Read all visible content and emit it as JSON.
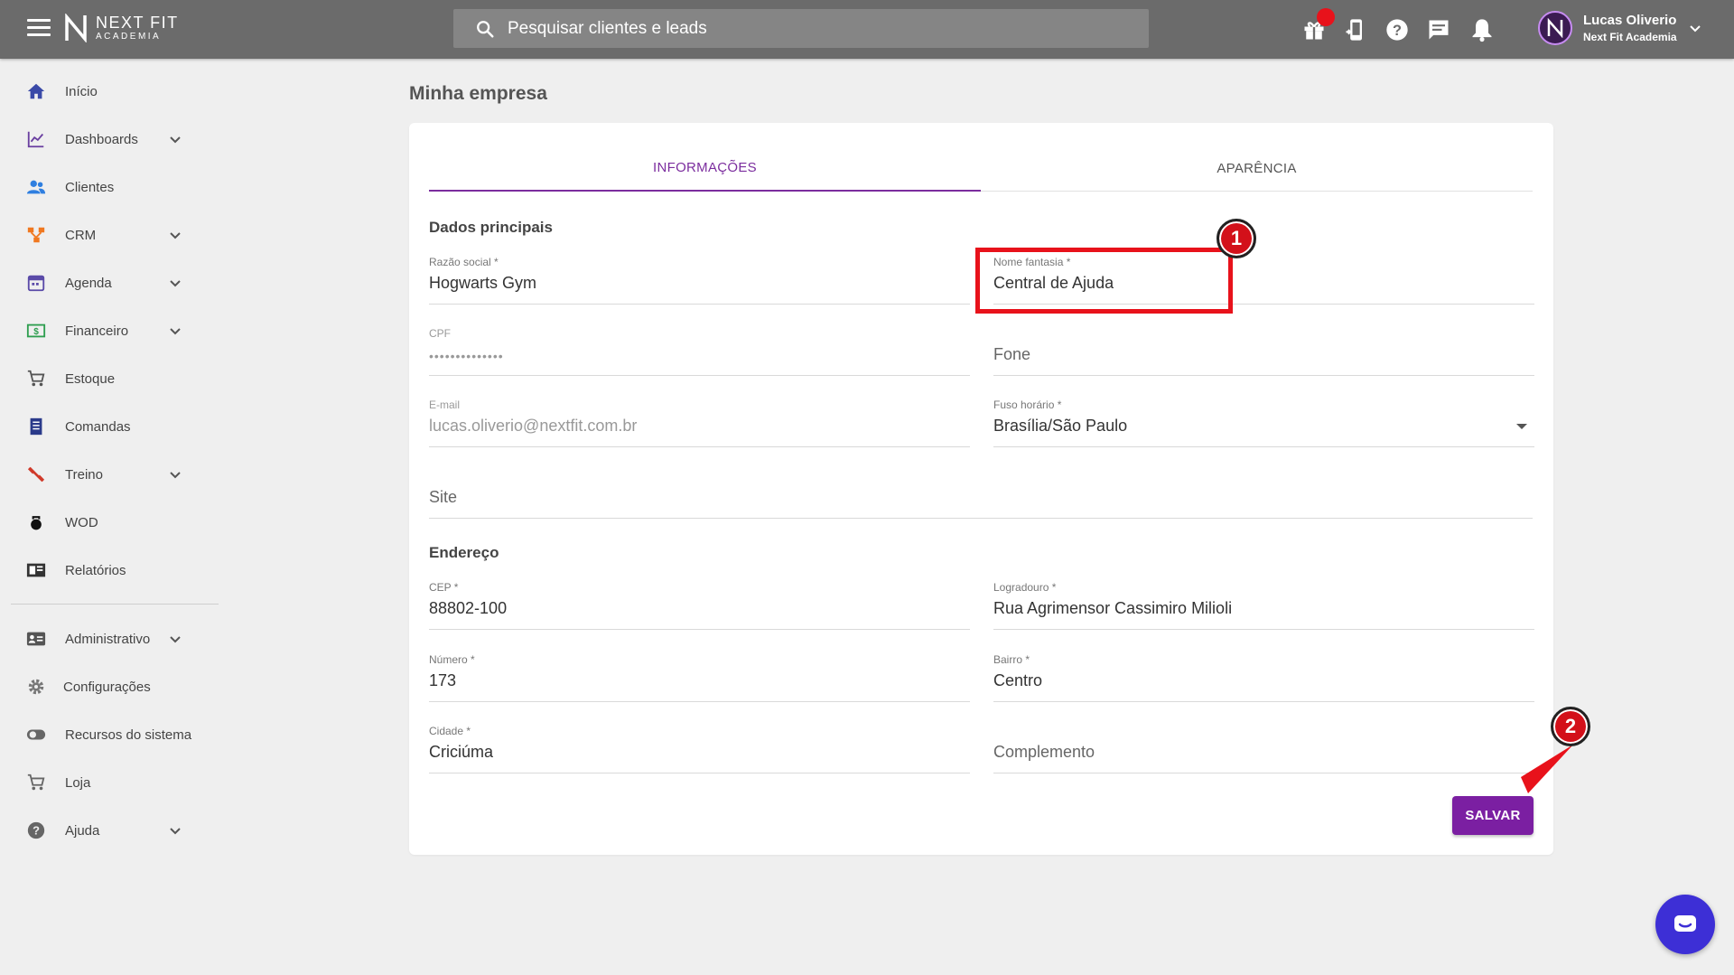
{
  "brand": {
    "name": "NEXT FIT",
    "subtitle": "ACADEMIA"
  },
  "search": {
    "placeholder": "Pesquisar clientes e leads"
  },
  "user": {
    "name": "Lucas Oliverio",
    "company": "Next Fit Academia"
  },
  "sidebar": {
    "items": [
      {
        "label": "Início",
        "icon": "home-icon",
        "color": "#3a4aa8"
      },
      {
        "label": "Dashboards",
        "icon": "chart-line-icon",
        "color": "#6a3fa0"
      },
      {
        "label": "Clientes",
        "icon": "people-icon",
        "color": "#2f7fe0"
      },
      {
        "label": "CRM",
        "icon": "crm-icon",
        "color": "#f07820"
      },
      {
        "label": "Agenda",
        "icon": "calendar-icon",
        "color": "#5a4aa8"
      },
      {
        "label": "Financeiro",
        "icon": "money-icon",
        "color": "#2e9e4f"
      },
      {
        "label": "Estoque",
        "icon": "cart-icon",
        "color": "#555555"
      },
      {
        "label": "Comandas",
        "icon": "receipt-icon",
        "color": "#2a3a8a"
      },
      {
        "label": "Treino",
        "icon": "dumbbell-icon",
        "color": "#d03a2a"
      },
      {
        "label": "WOD",
        "icon": "kettlebell-icon",
        "color": "#111111"
      },
      {
        "label": "Relatórios",
        "icon": "report-icon",
        "color": "#333333"
      },
      {
        "label": "Administrativo",
        "icon": "id-card-icon",
        "color": "#555555"
      },
      {
        "label": "Configurações",
        "icon": "gear-icon",
        "color": "#777777"
      },
      {
        "label": "Recursos do sistema",
        "icon": "toggle-icon",
        "color": "#666666"
      },
      {
        "label": "Loja",
        "icon": "cart-icon",
        "color": "#666666"
      },
      {
        "label": "Ajuda",
        "icon": "help-icon",
        "color": "#666666"
      }
    ]
  },
  "page": {
    "title": "Minha empresa"
  },
  "tabs": [
    {
      "label": "INFORMAÇÕES"
    },
    {
      "label": "APARÊNCIA"
    }
  ],
  "sections": {
    "main": "Dados principais",
    "address": "Endereço"
  },
  "fields": {
    "razao_social": {
      "label": "Razão social *",
      "value": "Hogwarts Gym"
    },
    "nome_fantasia": {
      "label": "Nome fantasia *",
      "value": "Central de Ajuda"
    },
    "cpf": {
      "label": "CPF",
      "value": "••••••••••••••"
    },
    "fone": {
      "placeholder": "Fone"
    },
    "email": {
      "label": "E-mail",
      "value": "lucas.oliverio@nextfit.com.br"
    },
    "fuso": {
      "label": "Fuso horário *",
      "value": "Brasília/São Paulo"
    },
    "site": {
      "placeholder": "Site"
    },
    "cep": {
      "label": "CEP *",
      "value": "88802-100"
    },
    "logradouro": {
      "label": "Logradouro *",
      "value": "Rua Agrimensor Cassimiro Milioli"
    },
    "numero": {
      "label": "Número *",
      "value": "173"
    },
    "bairro": {
      "label": "Bairro *",
      "value": "Centro"
    },
    "cidade": {
      "label": "Cidade *",
      "value": "Criciúma"
    },
    "complemento": {
      "placeholder": "Complemento"
    }
  },
  "actions": {
    "save": "SALVAR"
  },
  "annotations": {
    "step1": "1",
    "step2": "2"
  },
  "colors": {
    "accent": "#7b1fa2",
    "annotation": "#e8121b",
    "topbar": "#6b6b6b"
  }
}
